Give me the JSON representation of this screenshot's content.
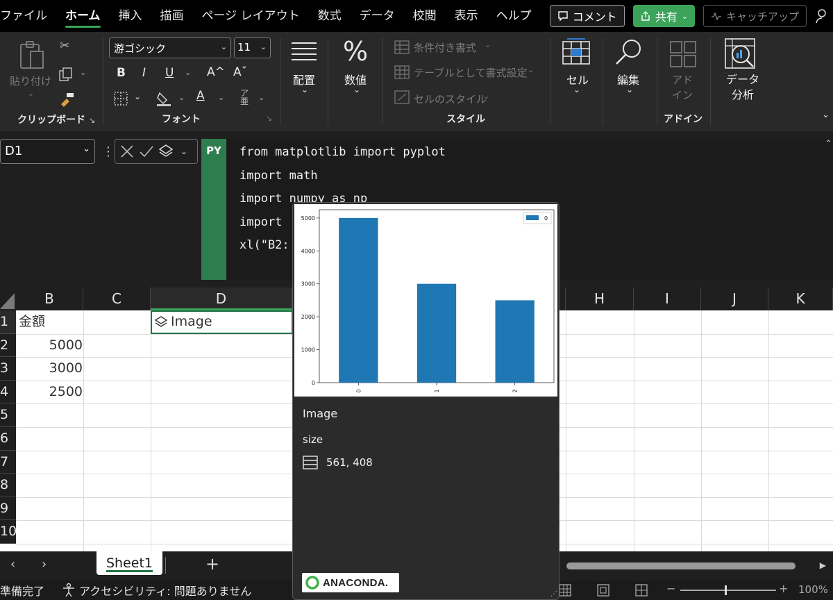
{
  "menu": {
    "tabs": [
      "ファイル",
      "ホーム",
      "挿入",
      "描画",
      "ページ レイアウト",
      "数式",
      "データ",
      "校閲",
      "表示",
      "ヘルプ"
    ],
    "active_tab": "ホーム",
    "comment_label": "コメント",
    "share_label": "共有",
    "catchup_label": "キャッチアップ"
  },
  "ribbon": {
    "paste_label": "貼り付け",
    "clipboard_label": "クリップボード",
    "font_name": "游ゴシック",
    "font_size": "11",
    "font_label": "フォント",
    "bold": "B",
    "italic": "I",
    "underline": "U",
    "grow_font": "A^",
    "shrink_font": "Aˇ",
    "font_color": "A",
    "alignment_label": "配置",
    "number_label": "数値",
    "conditional_format_label": "条件付き書式",
    "format_as_table_label": "テーブルとして書式設定",
    "cell_styles_label": "セルのスタイル",
    "styles_label": "スタイル",
    "cells_label": "セル",
    "editing_label": "編集",
    "addins_label": "アド\nイン",
    "addins_group_label": "アドイン",
    "analyze_label": "データ\n分析"
  },
  "formula_bar": {
    "name_box": "D1",
    "py_badge": "PY",
    "code_lines": [
      "from matplotlib import pyplot",
      "import math",
      "import numpy as np",
      "import ",
      "xl(\"B2:"
    ]
  },
  "grid": {
    "columns": [
      "B",
      "C",
      "D",
      "H",
      "I",
      "J",
      "K"
    ],
    "rows": [
      "1",
      "2",
      "3",
      "4",
      "5",
      "6",
      "7",
      "8",
      "9",
      "10"
    ],
    "b1": "金額",
    "b2": "5000",
    "b3": "3000",
    "b4": "2500",
    "d1": "Image"
  },
  "sheet": {
    "tab_name": "Sheet1",
    "add_label": "+"
  },
  "status": {
    "ready": "準備完了",
    "accessibility": "アクセシビリティ: 問題ありません",
    "zoom": "100%"
  },
  "card": {
    "title": "Image",
    "size_label": "size",
    "size_value": "561, 408",
    "logo_text": "ANACONDA."
  },
  "chart_data": {
    "type": "bar",
    "categories": [
      "0",
      "1",
      "2"
    ],
    "series": [
      {
        "name": "0",
        "values": [
          5000,
          3000,
          2500
        ]
      }
    ],
    "ylim": [
      0,
      5000
    ],
    "yticks": [
      0,
      1000,
      2000,
      3000,
      4000,
      5000
    ],
    "legend": "top-right",
    "bar_color": "#1f77b4"
  }
}
